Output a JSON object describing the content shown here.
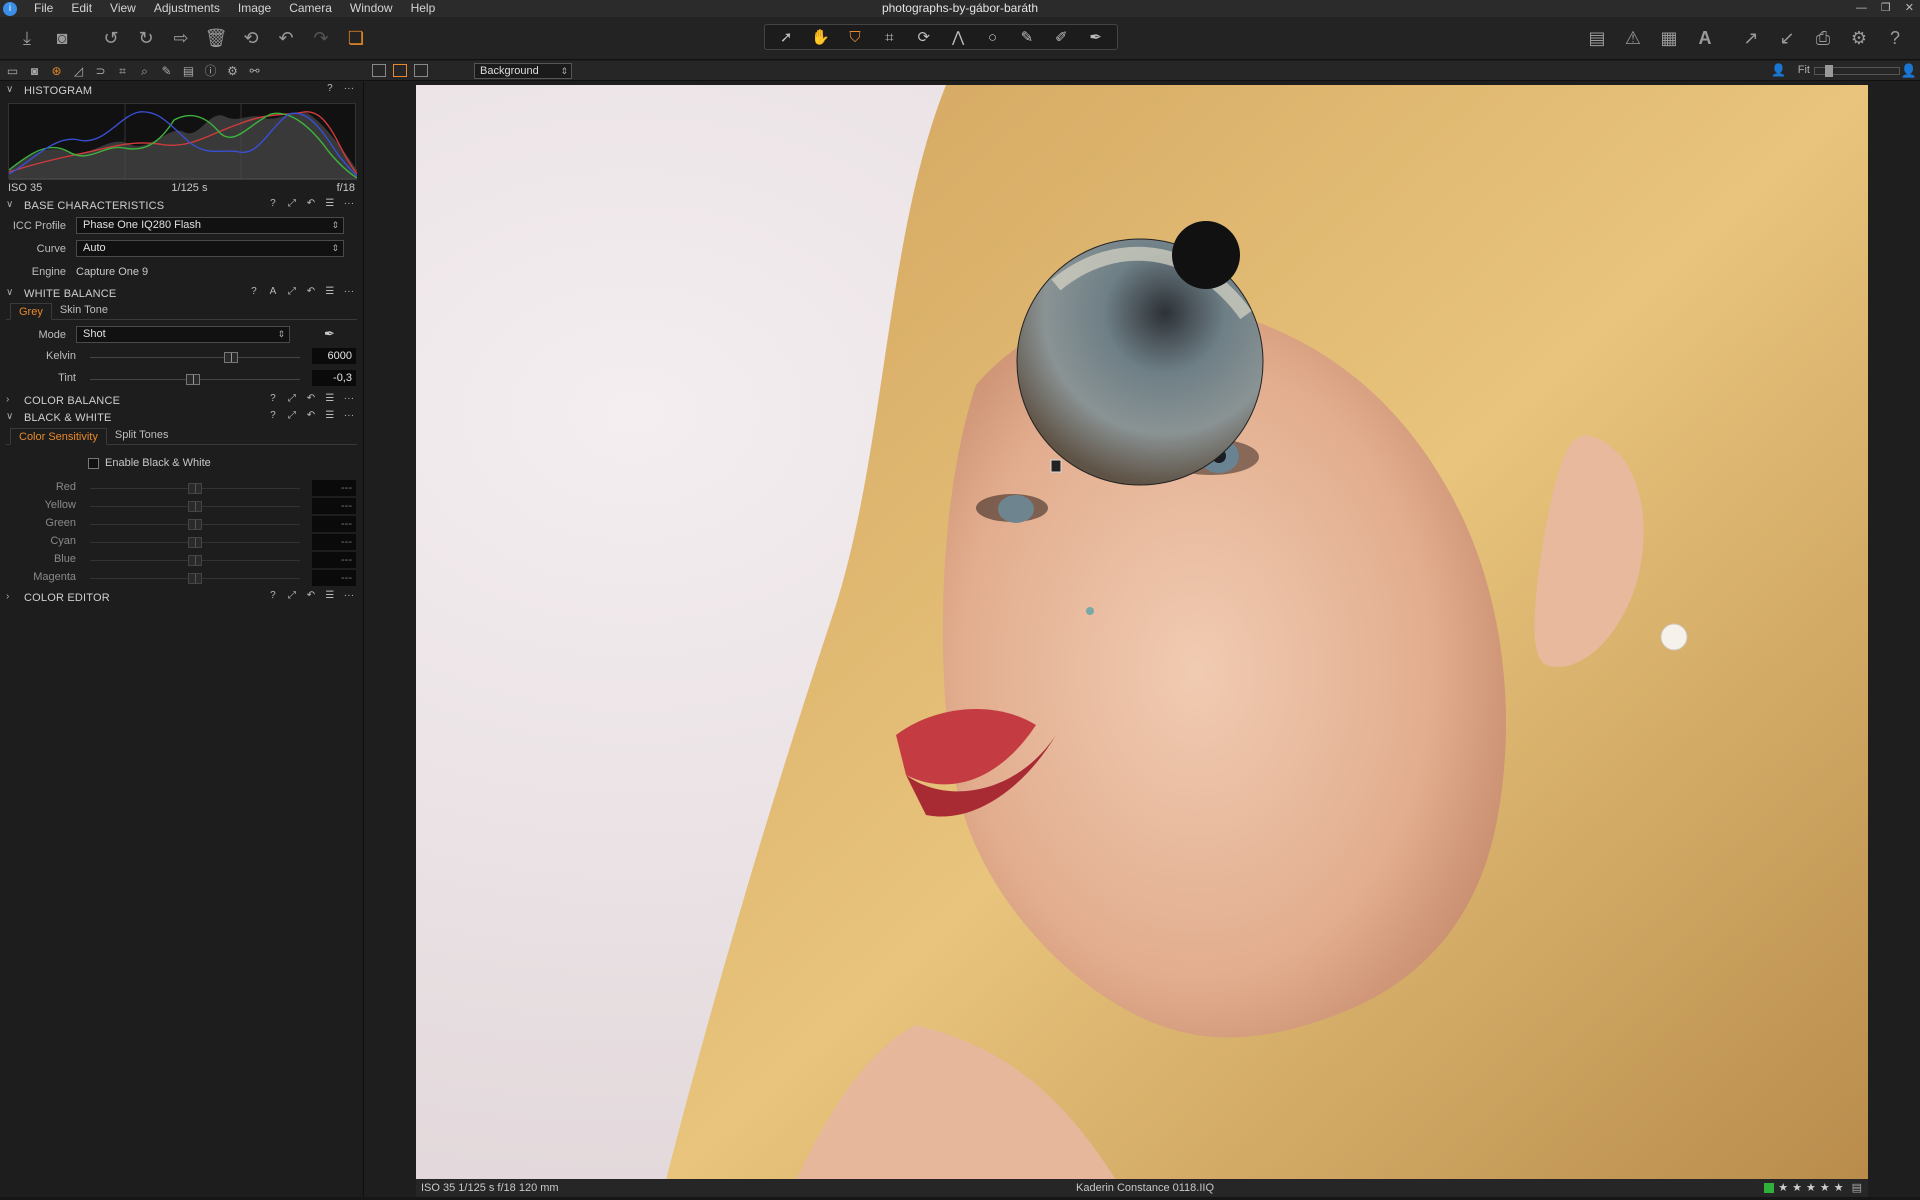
{
  "window": {
    "title": "photographs-by-gábor-baráth",
    "app_icon": "i"
  },
  "menu": {
    "items": [
      "File",
      "Edit",
      "View",
      "Adjustments",
      "Image",
      "Camera",
      "Window",
      "Help"
    ]
  },
  "toolbar": {
    "left_icons": [
      "import-icon",
      "camera-icon",
      "rotate-left-icon",
      "rotate-right-icon",
      "move-to-icon",
      "delete-icon",
      "reset-icon",
      "undo-icon",
      "redo-icon",
      "variants-icon"
    ],
    "center_tools": [
      "cursor-tool-icon",
      "pan-tool-icon",
      "loupe-tool-icon",
      "crop-tool-icon",
      "rotate-tool-icon",
      "keystone-tool-icon",
      "spot-removal-icon",
      "brush-icon",
      "gradient-icon",
      "picker-icon"
    ],
    "right_icons": [
      "layout-icon",
      "exposure-warning-icon",
      "grid-icon",
      "text-overlay-icon",
      "copy-adjustments-icon",
      "apply-adjustments-icon",
      "print-icon",
      "settings-icon",
      "help-icon"
    ]
  },
  "viewer_bar": {
    "layer": "Background",
    "fit_label": "Fit"
  },
  "histogram": {
    "title": "HISTOGRAM",
    "iso": "ISO 35",
    "shutter": "1/125 s",
    "aperture": "f/18"
  },
  "base_characteristics": {
    "title": "BASE CHARACTERISTICS",
    "icc_label": "ICC Profile",
    "icc_value": "Phase One IQ280 Flash",
    "curve_label": "Curve",
    "curve_value": "Auto",
    "engine_label": "Engine",
    "engine_value": "Capture One 9"
  },
  "white_balance": {
    "title": "WHITE BALANCE",
    "tabs": [
      "Grey",
      "Skin Tone"
    ],
    "mode_label": "Mode",
    "mode_value": "Shot",
    "kelvin_label": "Kelvin",
    "kelvin_value": "6000",
    "kelvin_fraction": 0.67,
    "tint_label": "Tint",
    "tint_value": "-0,3",
    "tint_fraction": 0.49
  },
  "color_balance": {
    "title": "COLOR BALANCE"
  },
  "black_white": {
    "title": "BLACK & WHITE",
    "tabs": [
      "Color Sensitivity",
      "Split Tones"
    ],
    "enable_label": "Enable Black & White",
    "sliders": [
      {
        "label": "Red",
        "value": "---"
      },
      {
        "label": "Yellow",
        "value": "---"
      },
      {
        "label": "Green",
        "value": "---"
      },
      {
        "label": "Cyan",
        "value": "---"
      },
      {
        "label": "Blue",
        "value": "---"
      },
      {
        "label": "Magenta",
        "value": "---"
      }
    ]
  },
  "color_editor": {
    "title": "COLOR EDITOR"
  },
  "status": {
    "exif": "ISO 35  1/125 s  f/18  120 mm",
    "filename": "Kaderin Constance 0118.IIQ",
    "color_tag": "#2eb03a",
    "rating_max": 5
  },
  "colors": {
    "accent": "#e8892b"
  }
}
